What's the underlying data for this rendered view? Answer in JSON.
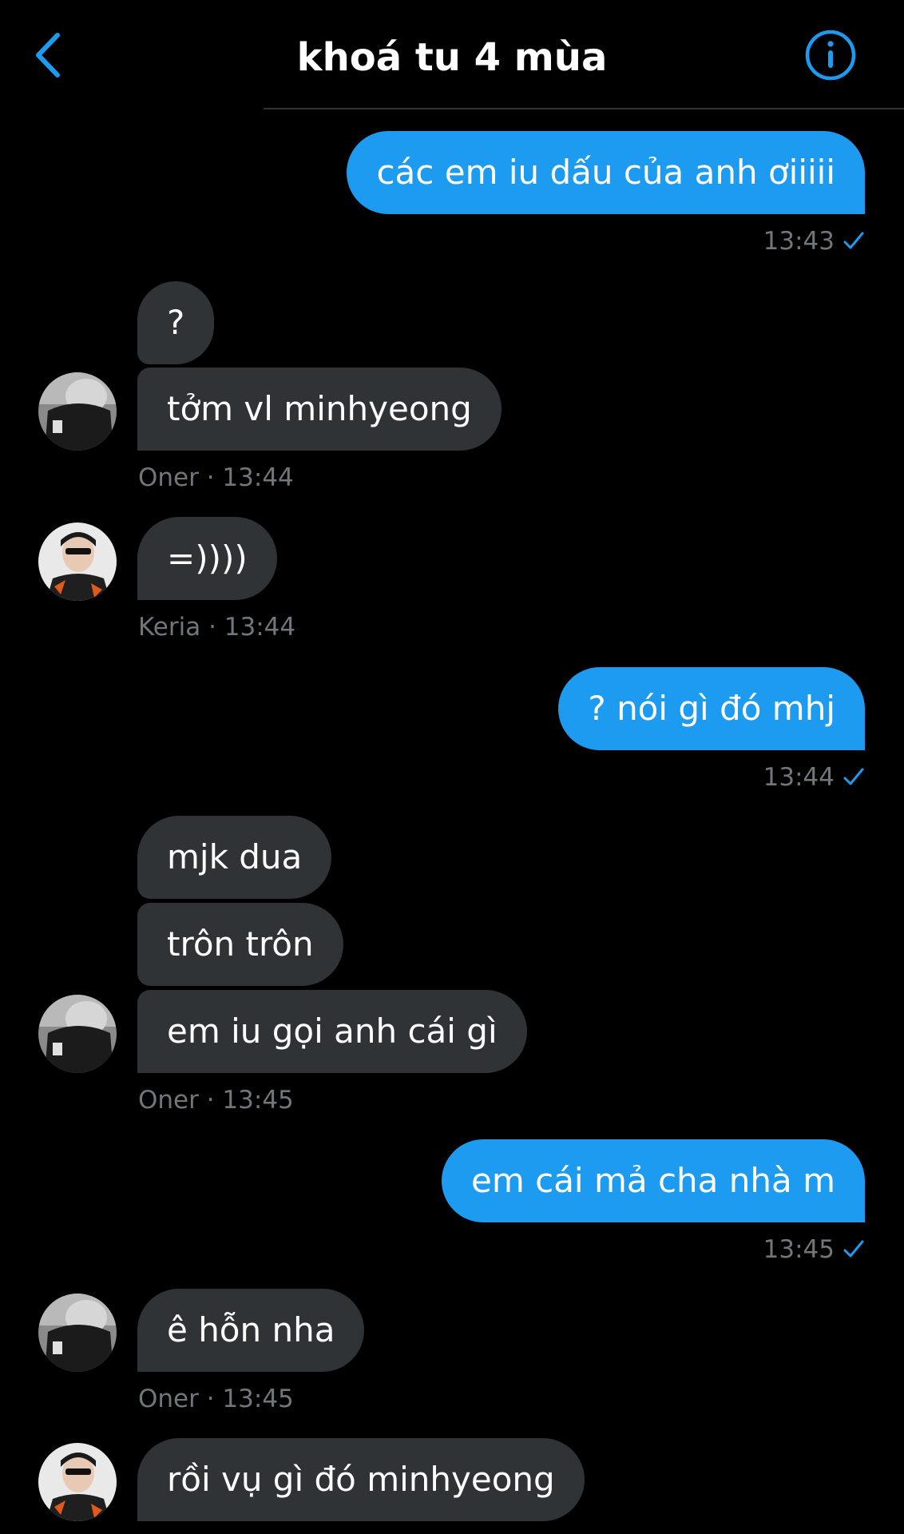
{
  "header": {
    "title": "khoá tu 4 mùa",
    "back_icon": "chevron-left-icon",
    "info_icon": "info-icon",
    "accent_color": "#1d9bf0"
  },
  "messages": [
    {
      "direction": "out",
      "text": "các em iu dấu của anh ơiiiii",
      "time": "13:43"
    },
    {
      "direction": "in",
      "text": "?"
    },
    {
      "direction": "in",
      "text": "tởm vl minhyeong",
      "meta": "Oner · 13:44"
    },
    {
      "direction": "in",
      "text": "=))))",
      "meta": "Keria · 13:44"
    },
    {
      "direction": "out",
      "text": "? nói gì đó mhj",
      "time": "13:44"
    },
    {
      "direction": "in",
      "text": "mjk dua"
    },
    {
      "direction": "in",
      "text": "trôn trôn"
    },
    {
      "direction": "in",
      "text": "em iu gọi anh cái gì",
      "meta": "Oner · 13:45"
    },
    {
      "direction": "out",
      "text": "em cái mả cha nhà m",
      "time": "13:45"
    },
    {
      "direction": "in",
      "text": "ê hỗn nha",
      "meta": "Oner · 13:45"
    },
    {
      "direction": "in",
      "text": "rồi vụ gì đó minhyeong"
    }
  ],
  "colors": {
    "background": "#000000",
    "outgoing_bubble": "#1d9bf0",
    "incoming_bubble": "#2f3336",
    "meta_text": "#71767b"
  }
}
